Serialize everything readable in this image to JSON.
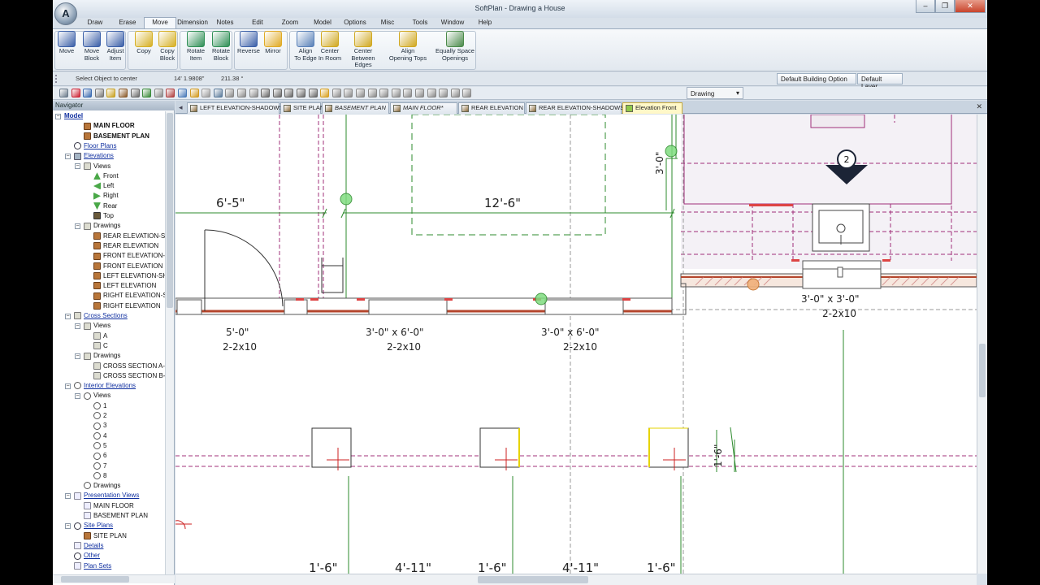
{
  "window": {
    "title": "SoftPlan - Drawing a House",
    "logo_letter": "A"
  },
  "menu_tabs": [
    "Draw",
    "Erase",
    "Move",
    "Dimension",
    "Notes",
    "Edit",
    "Zoom",
    "Model",
    "Options",
    "Misc",
    "Tools",
    "Window",
    "Help"
  ],
  "active_menu_tab": "Move",
  "ribbon": {
    "buttons": [
      {
        "label": "Move",
        "sub": ""
      },
      {
        "label": "Move",
        "sub": "Block"
      },
      {
        "label": "Adjust",
        "sub": "Item"
      },
      {
        "label": "Copy",
        "sub": ""
      },
      {
        "label": "Copy",
        "sub": "Block"
      },
      {
        "label": "Rotate",
        "sub": "Item"
      },
      {
        "label": "Rotate",
        "sub": "Block"
      },
      {
        "label": "Reverse",
        "sub": ""
      },
      {
        "label": "Mirror",
        "sub": ""
      },
      {
        "label": "Align",
        "sub": "To Edge"
      },
      {
        "label": "Center",
        "sub": "In Room"
      },
      {
        "label": "Center",
        "sub": "Between Edges"
      },
      {
        "label": "Align",
        "sub": "Opening Tops"
      },
      {
        "label": "Equally Space",
        "sub": "Openings"
      }
    ]
  },
  "prompt": {
    "text": "Select Object to center",
    "coord1": "14' 1.9808\"",
    "coord2": "211.38 °"
  },
  "options": {
    "building": "Default Building Option",
    "layer": "Default Layer"
  },
  "view_select": "Drawing",
  "tree": {
    "header": "Navigator",
    "items": [
      {
        "label": "Model",
        "style": "link bold",
        "indent": 0,
        "expander": "−"
      },
      {
        "label": "MAIN FLOOR",
        "style": "bold",
        "indent": 2,
        "icon": "plan"
      },
      {
        "label": "BASEMENT PLAN",
        "style": "bold",
        "indent": 2,
        "icon": "plan"
      },
      {
        "label": "Floor Plans",
        "style": "link",
        "indent": 1,
        "icon": "softplan"
      },
      {
        "label": "Elevations",
        "style": "link",
        "indent": 1,
        "icon": "elev",
        "expander": "−"
      },
      {
        "label": "Views",
        "style": "",
        "indent": 2,
        "icon": "views",
        "expander": "−"
      },
      {
        "label": "Front",
        "style": "",
        "indent": 3,
        "icon": "arrow-up"
      },
      {
        "label": "Left",
        "style": "",
        "indent": 3,
        "icon": "arrow-left"
      },
      {
        "label": "Right",
        "style": "",
        "indent": 3,
        "icon": "arrow-right"
      },
      {
        "label": "Rear",
        "style": "",
        "indent": 3,
        "icon": "arrow-down"
      },
      {
        "label": "Top",
        "style": "",
        "indent": 3,
        "icon": "top"
      },
      {
        "label": "Drawings",
        "style": "",
        "indent": 2,
        "icon": "views",
        "expander": "−"
      },
      {
        "label": "REAR ELEVATION-SHA",
        "style": "",
        "indent": 3,
        "icon": "plan"
      },
      {
        "label": "REAR ELEVATION",
        "style": "",
        "indent": 3,
        "icon": "plan"
      },
      {
        "label": "FRONT ELEVATION-SH",
        "style": "",
        "indent": 3,
        "icon": "plan"
      },
      {
        "label": "FRONT ELEVATION",
        "style": "",
        "indent": 3,
        "icon": "plan"
      },
      {
        "label": "LEFT ELEVATION-SHAI",
        "style": "",
        "indent": 3,
        "icon": "plan"
      },
      {
        "label": "LEFT ELEVATION",
        "style": "",
        "indent": 3,
        "icon": "plan"
      },
      {
        "label": "RIGHT ELEVATION-SH",
        "style": "",
        "indent": 3,
        "icon": "plan"
      },
      {
        "label": "RIGHT ELEVATION",
        "style": "",
        "indent": 3,
        "icon": "plan"
      },
      {
        "label": "Cross Sections",
        "style": "link",
        "indent": 1,
        "icon": "views",
        "expander": "−"
      },
      {
        "label": "Views",
        "style": "",
        "indent": 2,
        "icon": "views",
        "expander": "−"
      },
      {
        "label": "A",
        "style": "",
        "indent": 3,
        "icon": "views"
      },
      {
        "label": "C",
        "style": "",
        "indent": 3,
        "icon": "views"
      },
      {
        "label": "Drawings",
        "style": "",
        "indent": 2,
        "icon": "views",
        "expander": "−"
      },
      {
        "label": "CROSS SECTION A-A",
        "style": "",
        "indent": 3,
        "icon": "views"
      },
      {
        "label": "CROSS SECTION B-B",
        "style": "",
        "indent": 3,
        "icon": "views"
      },
      {
        "label": "Interior Elevations",
        "style": "link",
        "indent": 1,
        "icon": "target",
        "expander": "−"
      },
      {
        "label": "Views",
        "style": "",
        "indent": 2,
        "icon": "target",
        "expander": "−"
      },
      {
        "label": "1",
        "style": "",
        "indent": 3,
        "icon": "target"
      },
      {
        "label": "2",
        "style": "",
        "indent": 3,
        "icon": "target"
      },
      {
        "label": "3",
        "style": "",
        "indent": 3,
        "icon": "target"
      },
      {
        "label": "4",
        "style": "",
        "indent": 3,
        "icon": "target"
      },
      {
        "label": "5",
        "style": "",
        "indent": 3,
        "icon": "target"
      },
      {
        "label": "6",
        "style": "",
        "indent": 3,
        "icon": "target"
      },
      {
        "label": "7",
        "style": "",
        "indent": 3,
        "icon": "target"
      },
      {
        "label": "8",
        "style": "",
        "indent": 3,
        "icon": "target"
      },
      {
        "label": "Drawings",
        "style": "",
        "indent": 2,
        "icon": "target"
      },
      {
        "label": "Presentation Views",
        "style": "link",
        "indent": 1,
        "icon": "page",
        "expander": "−"
      },
      {
        "label": "MAIN FLOOR",
        "style": "",
        "indent": 2,
        "icon": "page"
      },
      {
        "label": "BASEMENT PLAN",
        "style": "",
        "indent": 2,
        "icon": "page"
      },
      {
        "label": "Site Plans",
        "style": "link",
        "indent": 1,
        "icon": "softplan",
        "expander": "−"
      },
      {
        "label": "SITE PLAN",
        "style": "",
        "indent": 2,
        "icon": "plan"
      },
      {
        "label": "Details",
        "style": "link",
        "indent": 1,
        "icon": "page"
      },
      {
        "label": "Other",
        "style": "link",
        "indent": 1,
        "icon": "softplan"
      },
      {
        "label": "Plan Sets",
        "style": "link",
        "indent": 1,
        "icon": "page"
      }
    ]
  },
  "drawing_tabs": [
    {
      "label": "LEFT ELEVATION-SHADOWS",
      "style": ""
    },
    {
      "label": "SITE PLAN",
      "style": ""
    },
    {
      "label": "BASEMENT PLAN",
      "style": "ital"
    },
    {
      "label": "MAIN FLOOR*",
      "style": "ital"
    },
    {
      "label": "REAR ELEVATION",
      "style": ""
    },
    {
      "label": "REAR ELEVATION-SHADOWS",
      "style": ""
    },
    {
      "label": "Elevation Front",
      "style": "active"
    }
  ],
  "dimensions": {
    "d1": "6'-5\"",
    "d2": "12'-6\"",
    "d3": "3'-0\"",
    "d4": "5'-0\"",
    "d4b": "2-2x10",
    "d5": "3'-0\" x 6'-0\"",
    "d5b": "2-2x10",
    "d6": "3'-0\" x 6'-0\"",
    "d6b": "2-2x10",
    "d7": "3'-0\" x 3'-0\"",
    "d7b": "2-2x10",
    "d8": "1'-6\"",
    "b1": "1'-6\"",
    "b2": "4'-11\"",
    "b3": "1'-6\"",
    "b4": "4'-11\"",
    "b5": "1'-6\"",
    "tag": "2"
  },
  "colors": {
    "accent": "#d9e1ea",
    "wall": "#b4462c",
    "dim_green": "#2e8b2e",
    "magenta_dash": "#a0307a"
  }
}
